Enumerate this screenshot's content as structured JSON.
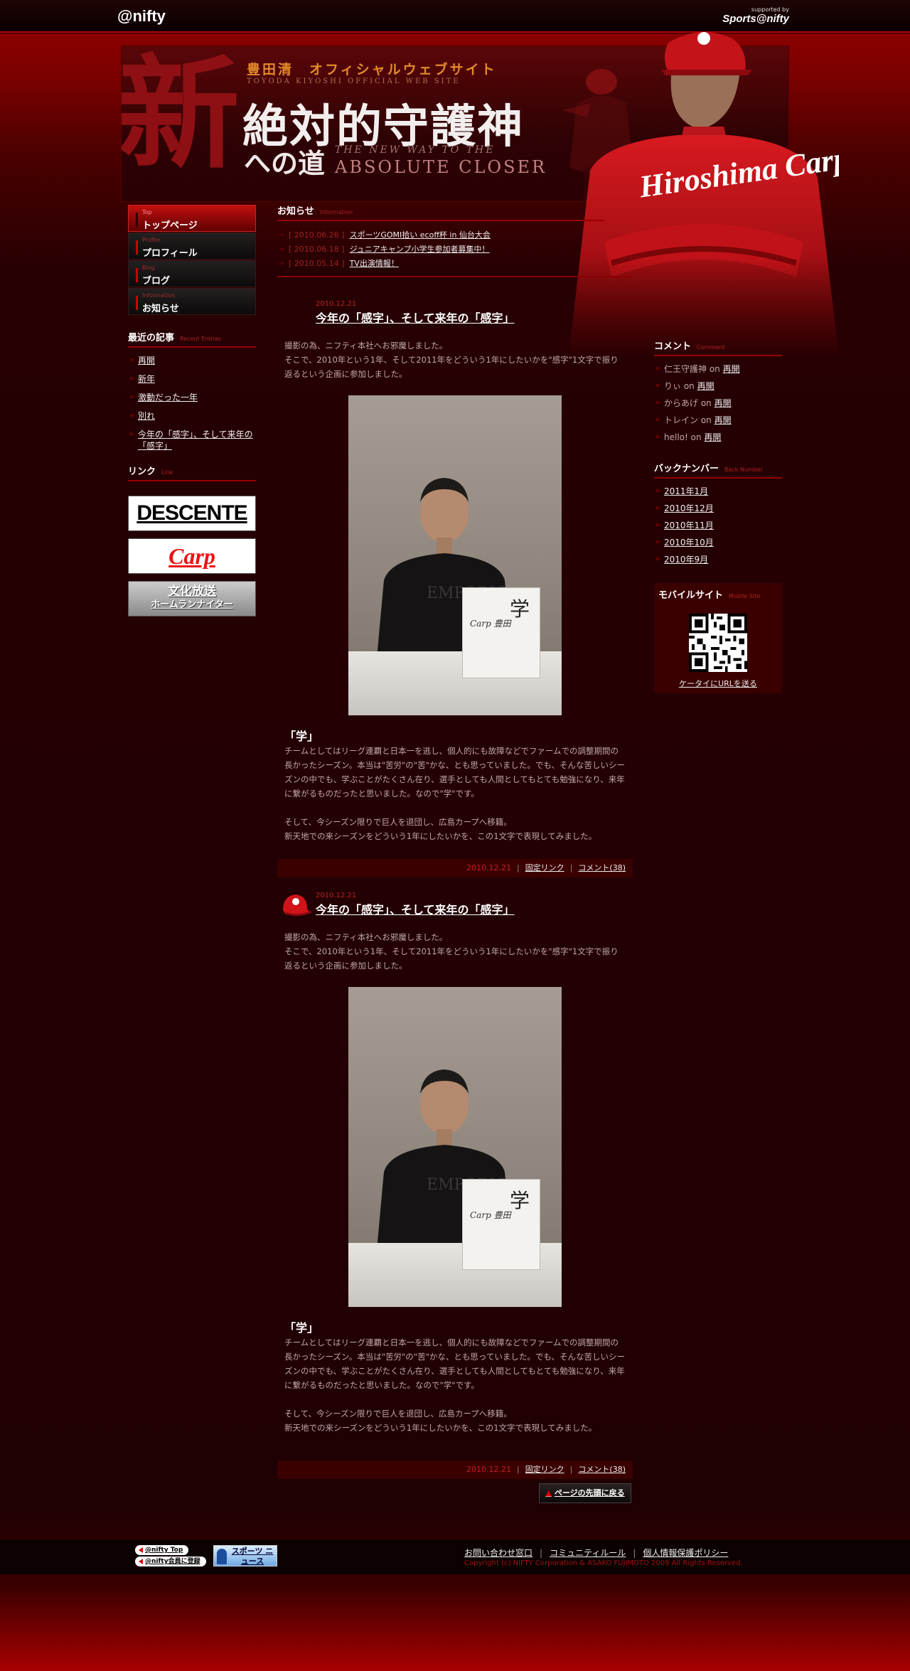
{
  "topbar": {
    "logo": "@nifty",
    "supported_line1": "supported by",
    "supported_line2": "Sports@nifty"
  },
  "header": {
    "big_char": "新",
    "subtitle_jp": "豊田清　オフィシャルウェブサイト",
    "subtitle_en": "TOYODA KIYOSHI OFFICIAL WEB SITE",
    "main_title": "絶対的守護神",
    "sub_title": "への道",
    "eng_line1": "THE NEW WAY TO THE",
    "eng_line2": "ABSOLUTE CLOSER"
  },
  "nav": [
    {
      "en": "Top",
      "label": "トップページ",
      "active": true
    },
    {
      "en": "Profile",
      "label": "プロフィール",
      "active": false
    },
    {
      "en": "Blog",
      "label": "ブログ",
      "active": false
    },
    {
      "en": "Information",
      "label": "お知らせ",
      "active": false
    }
  ],
  "recent": {
    "title": "最近の記事",
    "sub": "Recent Entries",
    "items": [
      "再開",
      "新年",
      "激動だった一年",
      "別れ",
      "今年の「感字」、そして来年の「感字」"
    ]
  },
  "links": {
    "title": "リンク",
    "sub": "Link",
    "desc": "DESCENTE",
    "carp": "Carp",
    "bunka_l1": "文化放送",
    "bunka_l2": "ホームランナイター"
  },
  "news": {
    "title": "お知らせ",
    "sub": "Information",
    "items": [
      {
        "date": "2010.06.26",
        "text": "スポーツGOMI拾い ecoff杯 in 仙台大会"
      },
      {
        "date": "2010.06.18",
        "text": "ジュニアキャンプ小学生参加者募集中！"
      },
      {
        "date": "2010.05.14",
        "text": "TV出演情報！"
      }
    ]
  },
  "posts": [
    {
      "date": "2010.12.21",
      "title": "今年の「感字」、そして来年の「感字」",
      "intro1": "撮影の為、ニフティ本社へお邪魔しました。",
      "intro2": "そこで、2010年という1年、そして2011年をどういう1年にしたいかを\"感字\"1文字で振り返るという企画に参加しました。",
      "photo_kanji": "学",
      "photo_sig": "Carp 豊田",
      "subhead": "「学」",
      "body1": "チームとしてはリーグ連覇と日本一を逃し、個人的にも故障などでファームでの調整期間の長かったシーズン。本当は\"苦労\"の\"苦\"かな、とも思っていました。でも、そんな苦しいシーズンの中でも、学ぶことがたくさん在り、選手としても人間としてもとても勉強になり、来年に繋がるものだったと思いました。なので\"学\"です。",
      "body2": "そして、今シーズン限りで巨人を退団し、広島カープへ移籍。",
      "body3": "新天地での来シーズンをどういう1年にしたいかを、この1文字で表現してみました。",
      "foot_date": "2010.12.21",
      "permalink": "固定リンク",
      "comments": "コメント(38)"
    },
    {
      "date": "2010.12.21",
      "title": "今年の「感字」、そして来年の「感字」",
      "intro1": "撮影の為、ニフティ本社へお邪魔しました。",
      "intro2": "そこで、2010年という1年、そして2011年をどういう1年にしたいかを\"感字\"1文字で振り返るという企画に参加しました。",
      "photo_kanji": "学",
      "photo_sig": "Carp 豊田",
      "subhead": "「学」",
      "body1": "チームとしてはリーグ連覇と日本一を逃し、個人的にも故障などでファームでの調整期間の長かったシーズン。本当は\"苦労\"の\"苦\"かな、とも思っていました。でも、そんな苦しいシーズンの中でも、学ぶことがたくさん在り、選手としても人間としてもとても勉強になり、来年に繋がるものだったと思いました。なので\"学\"です。",
      "body2": "そして、今シーズン限りで巨人を退団し、広島カープへ移籍。",
      "body3": "新天地での来シーズンをどういう1年にしたいかを、この1文字で表現してみました。",
      "foot_date": "2010.12.21",
      "permalink": "固定リンク",
      "comments": "コメント(38)"
    }
  ],
  "back_top": "ページの先頭に戻る",
  "comments": {
    "title": "コメント",
    "sub": "Comment",
    "on": "on",
    "items": [
      {
        "who": "仁王守護神",
        "what": "再開"
      },
      {
        "who": "りぃ",
        "what": "再開"
      },
      {
        "who": "からあげ",
        "what": "再開"
      },
      {
        "who": "トレイン",
        "what": "再開"
      },
      {
        "who": "hello!",
        "what": "再開"
      }
    ]
  },
  "backnumber": {
    "title": "バックナンバー",
    "sub": "Back Number",
    "items": [
      "2011年1月",
      "2010年12月",
      "2010年11月",
      "2010年10月",
      "2010年9月"
    ]
  },
  "mobile": {
    "title": "モバイルサイト",
    "sub": "Mobile Site",
    "link": "ケータイにURLを送る"
  },
  "footer": {
    "btn1": "@nifty Top",
    "btn2": "@nifty会員に登録",
    "sports_news": "スポーツ ニュース",
    "link1": "お問い合わせ窓口",
    "link2": "コミュニティルール",
    "link3": "個人情報保護ポリシー",
    "copyright": "Copyright (c) NIFTY Corporation & ASAKO FUJIMOTO 2009 All Rights Reserved."
  }
}
